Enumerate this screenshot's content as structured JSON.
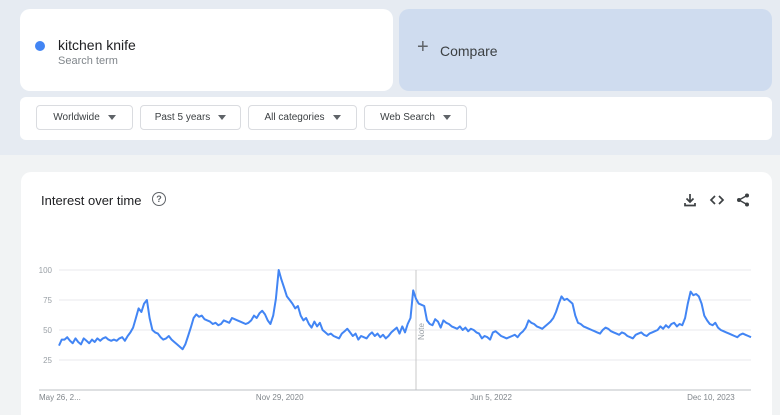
{
  "search_term": {
    "name": "kitchen knife",
    "subtitle": "Search term",
    "color": "#4285f4"
  },
  "compare": {
    "plus": "+",
    "label": "Compare"
  },
  "filters": [
    {
      "label": "Worldwide"
    },
    {
      "label": "Past 5 years"
    },
    {
      "label": "All categories"
    },
    {
      "label": "Web Search"
    }
  ],
  "chart": {
    "title": "Interest over time",
    "help_icon": "?",
    "icons": [
      "download-icon",
      "embed-icon",
      "share-icon"
    ],
    "note_label": "Note"
  },
  "chart_data": {
    "type": "line",
    "series": [
      {
        "name": "kitchen knife",
        "color": "#4285f4"
      }
    ],
    "y_ticks": [
      "100",
      "75",
      "50",
      "25"
    ],
    "ylim": [
      0,
      100
    ],
    "x_tick_labels": [
      "May 26, 2...",
      "Nov 29, 2020",
      "Jun 5, 2022",
      "Dec 10, 2023"
    ],
    "x_tick_index": [
      0,
      79,
      157,
      236
    ],
    "values": [
      37,
      42,
      42,
      44,
      41,
      39,
      43,
      40,
      38,
      43,
      41,
      39,
      42,
      40,
      43,
      41,
      43,
      44,
      42,
      41,
      42,
      41,
      43,
      44,
      41,
      45,
      48,
      52,
      60,
      68,
      65,
      72,
      75,
      60,
      50,
      48,
      47,
      44,
      42,
      43,
      45,
      42,
      40,
      38,
      36,
      34,
      38,
      45,
      52,
      60,
      63,
      61,
      62,
      59,
      58,
      57,
      55,
      56,
      54,
      55,
      58,
      57,
      56,
      60,
      59,
      58,
      57,
      56,
      55,
      56,
      58,
      62,
      60,
      64,
      66,
      63,
      58,
      55,
      62,
      76,
      100,
      92,
      85,
      78,
      75,
      72,
      68,
      70,
      62,
      58,
      60,
      55,
      52,
      57,
      53,
      56,
      50,
      48,
      46,
      47,
      45,
      44,
      43,
      47,
      49,
      51,
      48,
      45,
      47,
      42,
      45,
      44,
      43,
      46,
      48,
      45,
      47,
      44,
      46,
      43,
      45,
      48,
      50,
      52,
      47,
      53,
      48,
      55,
      60,
      83,
      76,
      72,
      71,
      70,
      58,
      55,
      54,
      59,
      57,
      52,
      58,
      56,
      55,
      53,
      52,
      51,
      53,
      50,
      52,
      49,
      51,
      50,
      48,
      47,
      43,
      45,
      44,
      42,
      48,
      49,
      47,
      45,
      44,
      43,
      44,
      45,
      46,
      44,
      47,
      49,
      52,
      58,
      56,
      55,
      53,
      52,
      51,
      53,
      55,
      57,
      60,
      65,
      72,
      78,
      75,
      76,
      74,
      72,
      62,
      56,
      55,
      53,
      52,
      51,
      50,
      49,
      48,
      47,
      50,
      52,
      51,
      49,
      48,
      47,
      46,
      48,
      47,
      45,
      44,
      43,
      46,
      47,
      48,
      46,
      45,
      47,
      48,
      49,
      50,
      53,
      51,
      54,
      52,
      55,
      56,
      53,
      55,
      54,
      60,
      72,
      82,
      79,
      80,
      78,
      72,
      62,
      58,
      55,
      54,
      56,
      52,
      50,
      49,
      48,
      47,
      46,
      45,
      44,
      46,
      47,
      46,
      45,
      44
    ]
  }
}
